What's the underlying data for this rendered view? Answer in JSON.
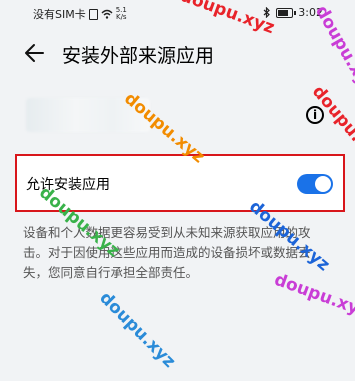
{
  "status_bar": {
    "carrier": "没有SIM卡",
    "net_speed_value": "5.1",
    "net_speed_unit": "K/s",
    "time": "3:02"
  },
  "header": {
    "title": "安装外部来源应用"
  },
  "setting": {
    "label": "允许安装应用",
    "enabled": true
  },
  "warning_text": "设备和个人数据更容易受到从未知来源获取应用的攻击。对于因使用这些应用而造成的设备损坏或数据丢失，您同意自行承担全部责任。",
  "info_icon": "i",
  "watermark": "doupu.xyz",
  "colors": {
    "accent": "#1a72e8",
    "highlight_border": "#d8161b"
  }
}
